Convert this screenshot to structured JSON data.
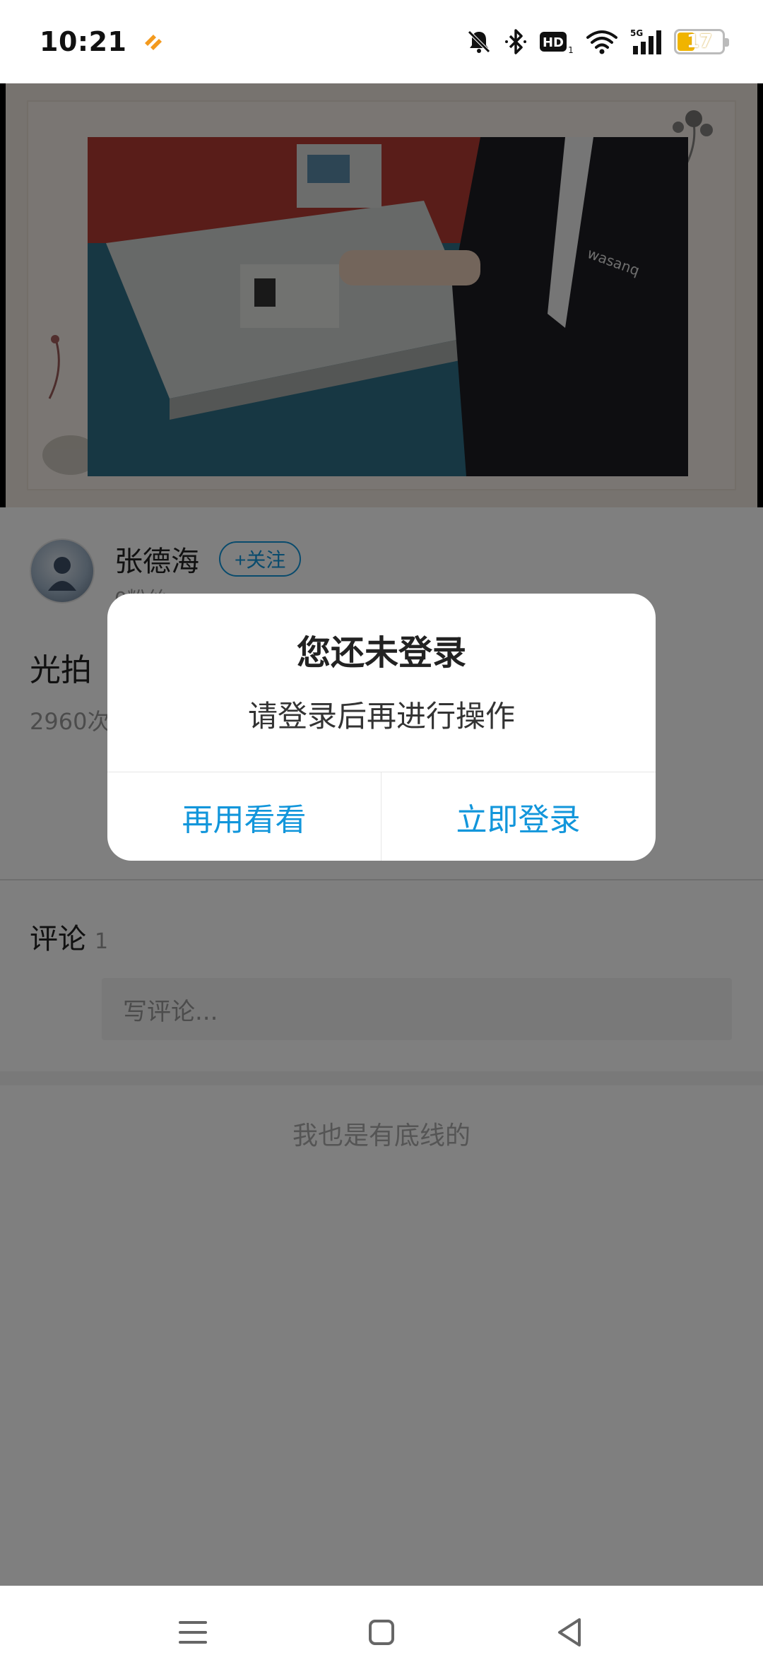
{
  "status_bar": {
    "time": "10:21",
    "battery_level": "17",
    "network_label": "5G",
    "hd_label": "HD",
    "icons": [
      "app-heart-icon",
      "mute-bell-icon",
      "bluetooth-icon",
      "hd-icon",
      "wifi-icon",
      "signal-icon",
      "battery-icon"
    ]
  },
  "author": {
    "name": "张德海",
    "follow_label": "+关注",
    "followers": "0粉丝"
  },
  "post": {
    "title": "光拍",
    "views": "2960次"
  },
  "comments": {
    "title": "评论",
    "count": "1",
    "input_placeholder": "写评论..."
  },
  "list_end": "我也是有底线的",
  "dialog": {
    "title": "您还未登录",
    "message": "请登录后再进行操作",
    "cancel_label": "再用看看",
    "confirm_label": "立即登录"
  },
  "nav": {
    "icons": [
      "menu-icon",
      "home-square-icon",
      "back-triangle-icon"
    ]
  },
  "colors": {
    "accent": "#1296db",
    "overlay": "rgba(0,0,0,0.5)",
    "battery": "#f0b400"
  }
}
